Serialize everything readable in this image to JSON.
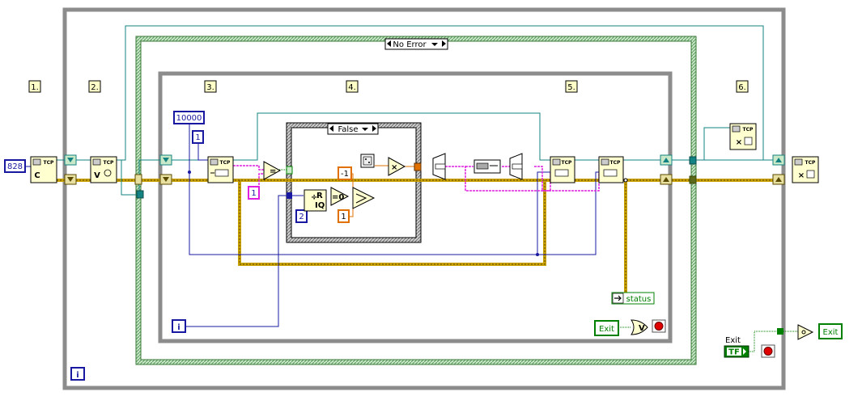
{
  "frames": [
    {
      "label": "1."
    },
    {
      "label": "2."
    },
    {
      "label": "3."
    },
    {
      "label": "4."
    },
    {
      "label": "5."
    },
    {
      "label": "6."
    }
  ],
  "constants": {
    "port": "828",
    "timeout": "10000",
    "bytes_to_read": "1",
    "compare_value": "1",
    "divisor": "2",
    "neg_one": "-1",
    "pos_one": "1"
  },
  "case_structures": {
    "error_case": "No Error",
    "inner_case": "False"
  },
  "function_labels": {
    "tcp": "TCP",
    "open_letter": "C",
    "listen_letter": "V",
    "equal": "=",
    "equal_zero": "=0",
    "multiply": "×",
    "quotient": "R",
    "iq": "IQ",
    "iteration": "i"
  },
  "indicators": {
    "status": "status",
    "exit_local": "Exit",
    "exit_label": "Exit",
    "exit_tf": "TF",
    "exit_out": "Exit",
    "or_gate": "V"
  },
  "colors": {
    "error_wire": "#c8a000",
    "error_wire_dark": "#5a4a00",
    "tcp_ref_wire": "#138282",
    "int_wire": "#1818a0",
    "string_wire": "#e020e0",
    "dbl_wire": "#e07000",
    "bool_wire": "#008000",
    "while_border": "#8a8a8a",
    "case_border": "#7a9a7a"
  }
}
